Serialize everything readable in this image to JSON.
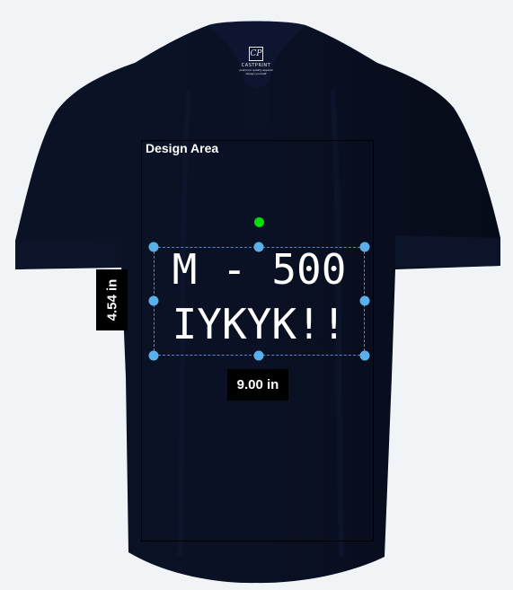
{
  "product": {
    "garment": "polo-shirt",
    "color": "#070d1c",
    "brand_logo": {
      "mark": "CP",
      "name": "CASTPRINT",
      "sub_lines": [
        "premium quality apparel",
        "design yourself"
      ]
    }
  },
  "design_area": {
    "label": "Design Area"
  },
  "design": {
    "text_lines": [
      "M - 500",
      "IYKYK!!"
    ],
    "text_color": "#ffffff",
    "selection_color": "#4a8fd6"
  },
  "dimensions": {
    "width_label": "9.00 in",
    "height_label": "4.54 in"
  },
  "colors": {
    "background": "#f1f4f7",
    "handle": "#5cb0ea",
    "rotate_handle": "#00e000"
  }
}
